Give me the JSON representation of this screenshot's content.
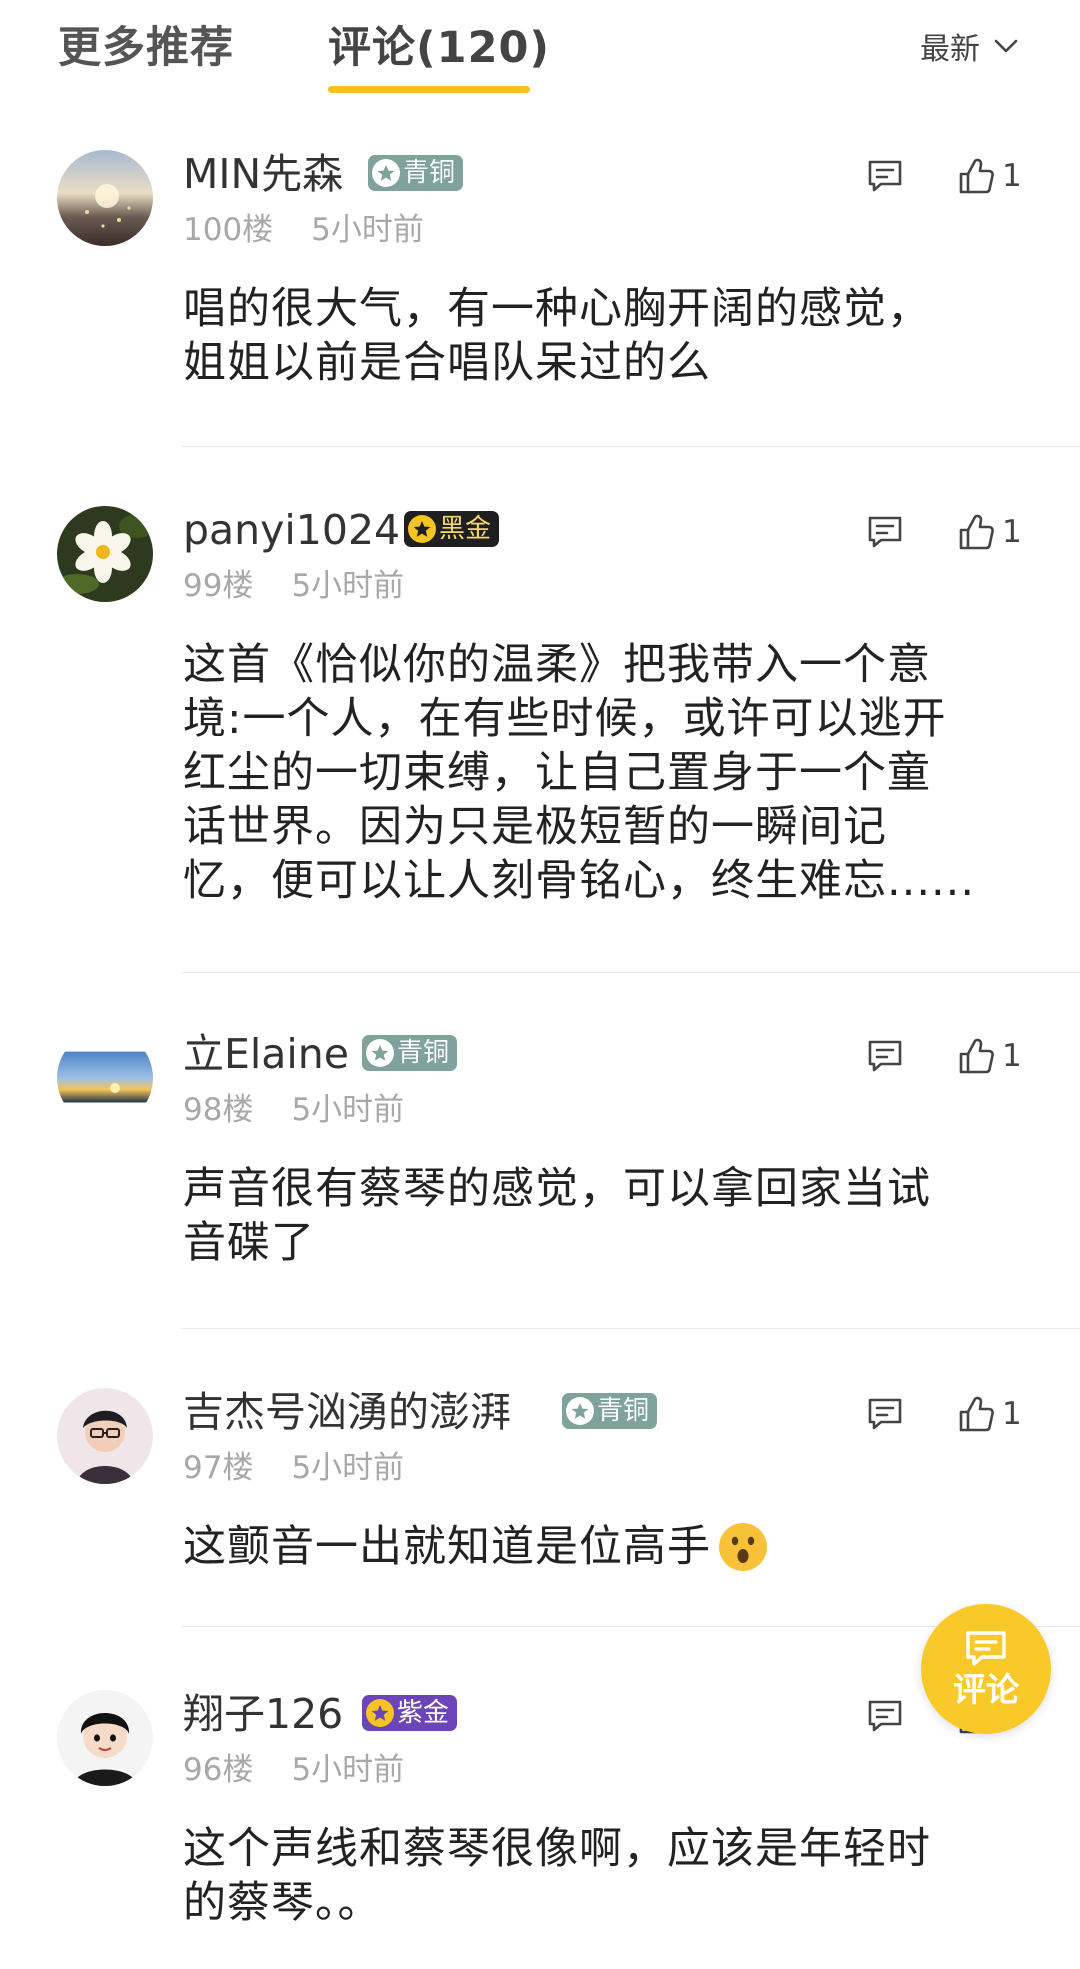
{
  "tabs": {
    "more_label": "更多推荐",
    "comments_label": "评论(120)",
    "active_color": "#f7c21b"
  },
  "sort": {
    "selected": "最新",
    "icon": "chevron-down-icon"
  },
  "comments": [
    {
      "username": "MIN先森",
      "badge": "青铜",
      "floor": "100楼",
      "time": "5小时前",
      "content": "唱的很大气，有一种心胸开阔的感觉，\n姐姐以前是合唱队呆过的么",
      "likes": "1"
    },
    {
      "username": "panyi1024",
      "badge": "黑金",
      "floor": "99楼",
      "time": "5小时前",
      "content": "这首《恰似你的温柔》把我带入一个意\n境:一个人，在有些时候，或许可以逃开\n红尘的一切束缚，让自己置身于一个童\n话世界。因为只是极短暂的一瞬间记\n忆，便可以让人刻骨铭心，终生难忘......",
      "likes": "1"
    },
    {
      "username": "立Elaine",
      "badge": "青铜",
      "floor": "98楼",
      "time": "5小时前",
      "content": "声音很有蔡琴的感觉，可以拿回家当试\n音碟了",
      "likes": "1"
    },
    {
      "username": "吉杰号汹湧的澎湃",
      "badge": "青铜",
      "floor": "97楼",
      "time": "5小时前",
      "content": "这颤音一出就知道是位高手",
      "emoji": "astonished-face-emoji",
      "likes": "1"
    },
    {
      "username": "翔子126",
      "badge": "紫金",
      "floor": "96楼",
      "time": "5小时前",
      "content": "这个声线和蔡琴很像啊，应该是年轻时\n的蔡琴。。",
      "likes": ""
    }
  ],
  "fab": {
    "label": "评论",
    "color": "#f8c928"
  }
}
